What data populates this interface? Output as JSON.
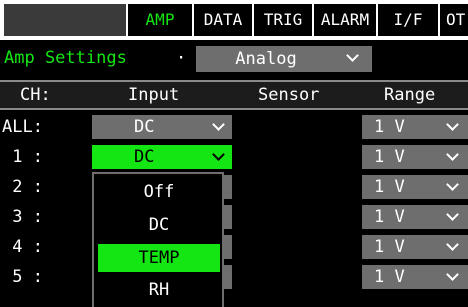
{
  "tabs": [
    {
      "label": ""
    },
    {
      "label": "AMP",
      "active": true
    },
    {
      "label": "DATA"
    },
    {
      "label": "TRIG"
    },
    {
      "label": "ALARM"
    },
    {
      "label": "I/F"
    },
    {
      "label": "OT"
    }
  ],
  "header": {
    "title": "Amp Settings",
    "separator": "·",
    "mode": "Analog"
  },
  "columns": {
    "ch": "CH:",
    "input": "Input",
    "sensor": "Sensor",
    "range": "Range"
  },
  "rows": [
    {
      "ch": "ALL:",
      "input": "DC",
      "range": "1 V"
    },
    {
      "ch": " 1 :",
      "input": "DC",
      "range": "1 V"
    },
    {
      "ch": " 2 :",
      "input": "",
      "range": "1 V"
    },
    {
      "ch": " 3 :",
      "input": "",
      "range": "1 V"
    },
    {
      "ch": " 4 :",
      "input": "",
      "range": "1 V"
    },
    {
      "ch": " 5 :",
      "input": "",
      "range": "1 V"
    }
  ],
  "dropdown": {
    "options": [
      "Off",
      "DC",
      "TEMP",
      "RH"
    ],
    "selected": "TEMP"
  },
  "colors": {
    "accent": "#14e614",
    "field": "#6e6e6e",
    "background": "#000000"
  }
}
